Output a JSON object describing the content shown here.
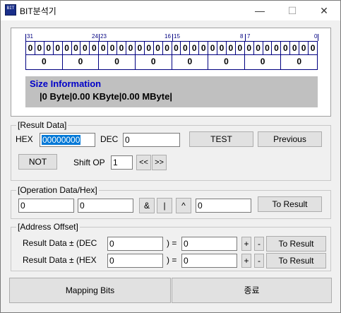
{
  "window": {
    "title": "BIT분석기",
    "icon_text": "BIT",
    "minimize_glyph": "—",
    "maximize_glyph": "☐",
    "close_glyph": "✕"
  },
  "bit_panel": {
    "ruler_labels": [
      "31",
      "24",
      "23",
      "16",
      "15",
      "8",
      "7",
      "0"
    ],
    "bits": [
      "0",
      "0",
      "0",
      "0",
      "0",
      "0",
      "0",
      "0",
      "0",
      "0",
      "0",
      "0",
      "0",
      "0",
      "0",
      "0",
      "0",
      "0",
      "0",
      "0",
      "0",
      "0",
      "0",
      "0",
      "0",
      "0",
      "0",
      "0",
      "0",
      "0",
      "0",
      "0"
    ],
    "nibbles": [
      "0",
      "0",
      "0",
      "0",
      "0",
      "0",
      "0",
      "0"
    ],
    "size_title": "Size Information",
    "size_value": "|0 Byte|0.00 KByte|0.00 MByte|"
  },
  "result_data": {
    "group_label": "[Result Data]",
    "hex_label": "HEX",
    "hex_value": "00000000",
    "dec_label": "DEC",
    "dec_value": "0",
    "test_button": "TEST",
    "previous_button": "Previous",
    "not_button": "NOT",
    "shift_label": "Shift OP",
    "shift_value": "1",
    "shift_left_button": "<<",
    "shift_right_button": ">>"
  },
  "operation": {
    "group_label": "[Operation Data/Hex]",
    "operand1_value": "0",
    "operand2_value": "0",
    "and_button": "&",
    "or_button": "|",
    "xor_button": "^",
    "result_value": "0",
    "to_result_button": "To Result"
  },
  "address_offset": {
    "group_label": "[Address Offset]",
    "row1_label": "Result Data ± (DEC",
    "row1_input": "0",
    "row1_eq": ") =",
    "row1_result": "0",
    "row2_label": "Result Data ± (HEX",
    "row2_input": "0",
    "row2_eq": ") =",
    "row2_result": "0",
    "plus_label": "+",
    "minus_label": "-",
    "to_result_button": "To Result"
  },
  "footer": {
    "mapping_button": "Mapping Bits",
    "exit_button": "종료"
  }
}
